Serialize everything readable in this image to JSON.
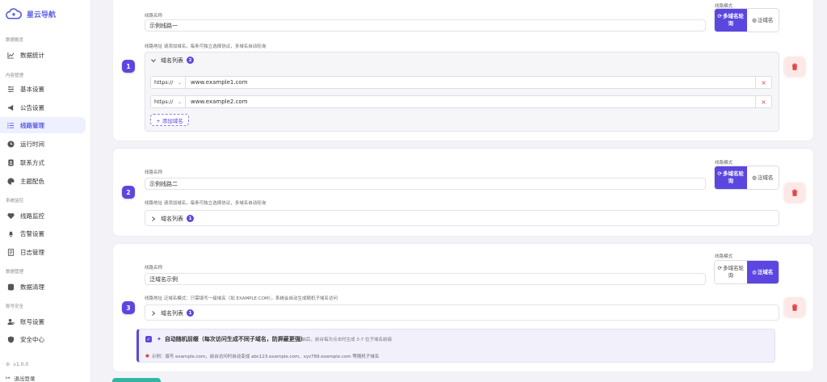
{
  "brand": {
    "title": "星云导航"
  },
  "sidebar": {
    "groups": [
      {
        "label": "数据概览",
        "items": [
          {
            "label": "数据统计",
            "icon": "chart-line-icon"
          }
        ]
      },
      {
        "label": "内容管理",
        "items": [
          {
            "label": "基本设置",
            "icon": "sliders-icon"
          },
          {
            "label": "公告设置",
            "icon": "megaphone-icon"
          },
          {
            "label": "线路管理",
            "icon": "list-icon",
            "active": true
          },
          {
            "label": "运行时间",
            "icon": "clock-icon"
          },
          {
            "label": "联系方式",
            "icon": "contact-card-icon"
          },
          {
            "label": "主题配色",
            "icon": "palette-icon"
          }
        ]
      },
      {
        "label": "系统监控",
        "items": [
          {
            "label": "线路监控",
            "icon": "heartbeat-icon"
          },
          {
            "label": "告警设置",
            "icon": "bell-icon"
          },
          {
            "label": "日志管理",
            "icon": "log-icon"
          }
        ]
      },
      {
        "label": "数据管理",
        "items": [
          {
            "label": "数据清理",
            "icon": "database-icon"
          }
        ]
      },
      {
        "label": "账号安全",
        "items": [
          {
            "label": "账号设置",
            "icon": "user-gear-icon"
          },
          {
            "label": "安全中心",
            "icon": "shield-icon"
          }
        ]
      }
    ],
    "version": "v1.0.0",
    "logout": "退出登录"
  },
  "labels": {
    "line_name": "线路名称",
    "line_mode": "线路模式",
    "domain_list": "域名列表",
    "add_domain": "+ 添加域名",
    "hint_multi": "线路地址 请添加域名，每条可独立选择协议，多域名自动轮询",
    "hint_wildcard": "线路地址 泛域名模式：只需填写一级域名（如 EXAMPLE.COM），系统会自动生成随机子域名访问",
    "mode_multi": "多域名轮询",
    "mode_wildcard": "泛域名"
  },
  "lines": [
    {
      "index": "1",
      "name": "示例线路一",
      "mode": "multi",
      "domain_count": "2",
      "expanded": true,
      "domains": [
        {
          "protocol": "https://",
          "host": "www.example1.com"
        },
        {
          "protocol": "https://",
          "host": "www.example2.com"
        }
      ]
    },
    {
      "index": "2",
      "name": "示例线路二",
      "mode": "multi",
      "domain_count": "1",
      "expanded": false
    },
    {
      "index": "3",
      "name": "泛域名示例",
      "mode": "wildcard",
      "domain_count": "1",
      "expanded": false
    }
  ],
  "auto_random": {
    "checked": true,
    "title": "自动随机前缀（每次访问生成不同子域名，防屏蔽更强）",
    "desc": "开启后，前台每次点击时生成 3-7 位子域名前缀",
    "example": "示例：填写 example.com，前台访问时自动变成 abc123.example.com、xyz789.example.com 等随机子域名"
  },
  "colors": {
    "accent": "#5b47e0",
    "danger": "#e04848",
    "save": "#2eb8a3"
  }
}
